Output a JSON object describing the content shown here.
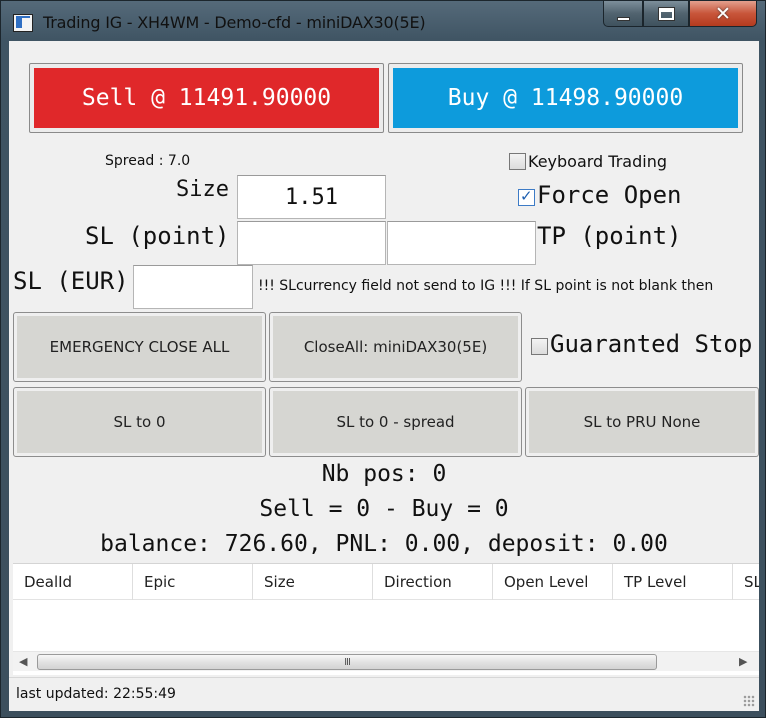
{
  "window": {
    "title": "Trading IG - XH4WM - Demo-cfd - miniDAX30(5E)",
    "close_glyph": "✕"
  },
  "trade": {
    "sell_label": "Sell @ 11491.90000",
    "buy_label": "Buy @ 11498.90000",
    "spread": "Spread : 7.0",
    "keyboard_trading_label": "Keyboard Trading",
    "keyboard_trading_checked": false,
    "size_label": "Size",
    "size_value": "1.51",
    "force_open_label": "Force Open",
    "force_open_checked": true,
    "sl_point_label": "SL (point)",
    "sl_point_value": "",
    "tp_point_label": "TP (point)",
    "tp_point_value": "",
    "sl_eur_label": "SL (EUR)",
    "sl_eur_value": "",
    "warning": "!!! SLcurrency field not send to IG !!! If SL point is not blank then"
  },
  "actions": {
    "emergency_close": "EMERGENCY CLOSE ALL",
    "close_all": "CloseAll: miniDAX30(5E)",
    "guaranteed_stop_label": "Guaranted Stop",
    "guaranteed_stop_checked": false,
    "sl_to_0": "SL to 0",
    "sl_to_0_spread": "SL to 0 - spread",
    "sl_to_pru": "SL to PRU None"
  },
  "summary": {
    "nb_pos": "Nb pos: 0",
    "sell_buy": "Sell = 0 - Buy = 0",
    "balance": "balance: 726.60, PNL: 0.00, deposit: 0.00"
  },
  "positions_table": {
    "columns": [
      "DealId",
      "Epic",
      "Size",
      "Direction",
      "Open Level",
      "TP Level",
      "SL Level"
    ],
    "rows": [],
    "scroll_thumb_glyph": "III"
  },
  "status": {
    "last_updated": "last updated: 22:55:49"
  },
  "colors": {
    "sell": "#e0282a",
    "buy": "#0d9bdc"
  }
}
